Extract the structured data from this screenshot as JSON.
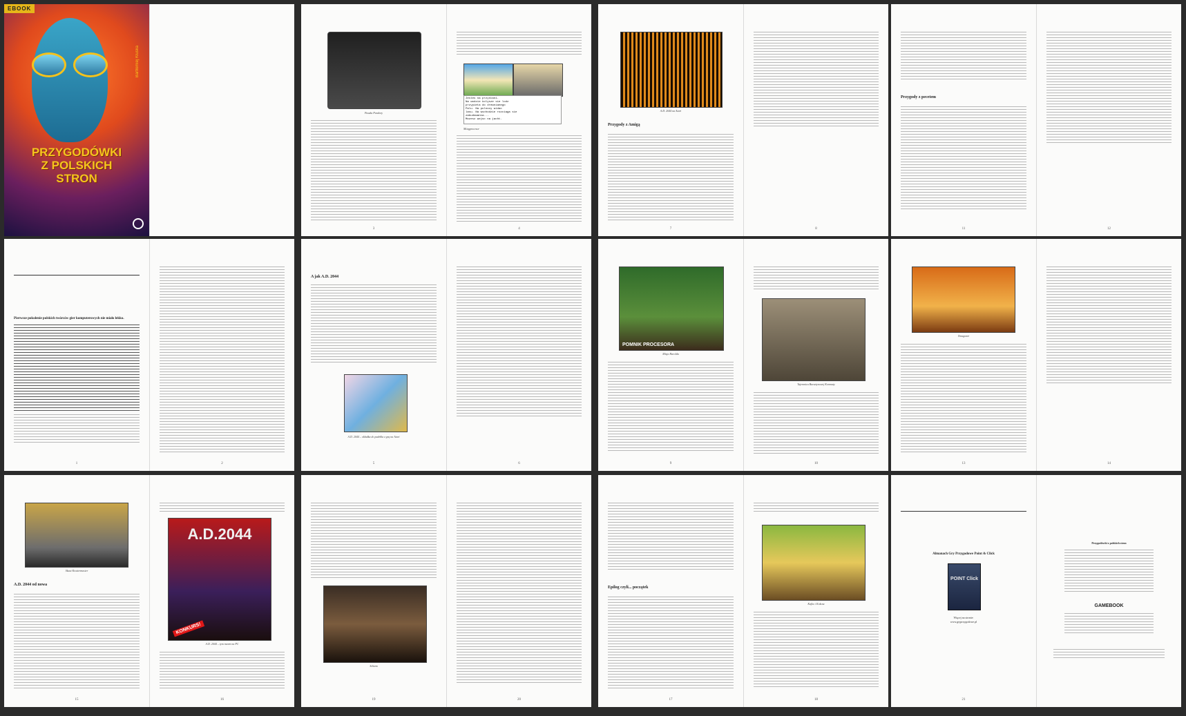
{
  "cover": {
    "badge": "EBOOK",
    "title_lines": [
      "PRZYGODÓWKI",
      "Z POLSKICH",
      "STRON"
    ],
    "author": "Bartłomiej Kluska"
  },
  "spread2": {
    "caption_left": "Puszka Pandory",
    "caption_right": "Mózgprocesor",
    "page_left": "3",
    "page_right": "4",
    "screen_text": [
      "Jestes na przystani.",
      "Na wodzie kolysze sie lodz",
      "przypieta do drewnianego",
      "Palu. Na polnocy widac",
      "lasu. Na wschodzie rozciaga sie",
      "zabudowania...",
      "Mozesz wejsc na jacht."
    ]
  },
  "spread3": {
    "caption_left": "A.D. 2044 na Atari",
    "heading_left": "Przygody z Amigą",
    "page_left": "7",
    "page_right": "8"
  },
  "spread4": {
    "heading_left": "Przygody z pecetem",
    "page_left": "11",
    "page_right": "12"
  },
  "spread5": {
    "intro_bold": "Pierwsze pokolenie polskich twórców gier komputerowych nie miało lekko.",
    "page_left": "1",
    "page_right": "2"
  },
  "spread6": {
    "heading_left": "A jak A.D. 2044",
    "caption_left": "A.D. 2044 – okładka do pudełka z grą na Atari",
    "page_left": "5",
    "page_right": "6"
  },
  "spread7": {
    "caption_left": "Misja Harolda",
    "caption_right": "Tajemnica Bursztynowej Komnaty",
    "sign_text": "POMNIK PROCESORA",
    "page_left": "9",
    "page_right": "10"
  },
  "spread8": {
    "caption_left": "Tenagonie",
    "page_left": "13",
    "page_right": "14"
  },
  "spread9": {
    "caption_left": "Skaut Kwatermaster",
    "heading_left": "A.D. 2044 od nowa",
    "poster_title": "A.D.2044",
    "poster_banner": "KONKURS!",
    "caption_right": "A.D. 2044 – tym razem na PC",
    "page_left": "15",
    "page_right": "16"
  },
  "spread10": {
    "caption_left": "Schizm",
    "page_left": "19",
    "page_right": "20"
  },
  "spread11": {
    "heading_left": "Epilog czyli... początek",
    "caption_right": "Kajko i Kokosz",
    "page_left": "17",
    "page_right": "18"
  },
  "spread12": {
    "almanach_title": "Almanach Gry Przygodowe Point & Click",
    "book_text": "POINT Click",
    "more_label": "Więcej na stronie:",
    "more_url": "www.gryprzygodowe.pl",
    "colophon_title": "Przygodówki z polskich stron",
    "publisher": "GAMEBOOK",
    "page_left": "21"
  }
}
